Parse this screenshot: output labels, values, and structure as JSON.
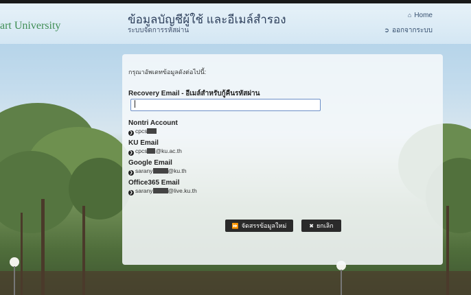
{
  "header": {
    "brand": "art University",
    "title": "ข้อมูลบัญชีผู้ใช้ และอีเมล์สำรอง",
    "subtitle": "ระบบจัดการรหัสผ่าน",
    "nav": [
      {
        "label": "Home",
        "icon": "home-icon"
      },
      {
        "label": "ออกจากระบบ",
        "icon": "sign-out-icon"
      }
    ]
  },
  "form": {
    "intro": "กรุณาอัพเดทข้อมูลดังต่อไปนี้:",
    "recovery_label": "Recovery Email - อีเมล์สำหรับกู้คืนรหัสผ่าน",
    "recovery_value": "",
    "recovery_placeholder": ""
  },
  "accounts": [
    {
      "name": "Nontri Account",
      "prefix": "cpcs",
      "suffix": ""
    },
    {
      "name": "KU Email",
      "prefix": "cpcs",
      "suffix": "@ku.ac.th"
    },
    {
      "name": "Google Email",
      "prefix": "sarany",
      "suffix": "@ku.th"
    },
    {
      "name": "Office365 Email",
      "prefix": "sarany",
      "suffix": "@live.ku.th"
    }
  ],
  "buttons": {
    "submit": "จัดสรรข้อมูลใหม่",
    "cancel": "ยกเลิก"
  },
  "colors": {
    "brand": "#3f8d54",
    "title": "#2d3f5b",
    "button": "#2a2a2a",
    "input_border": "#6b8ec7"
  }
}
